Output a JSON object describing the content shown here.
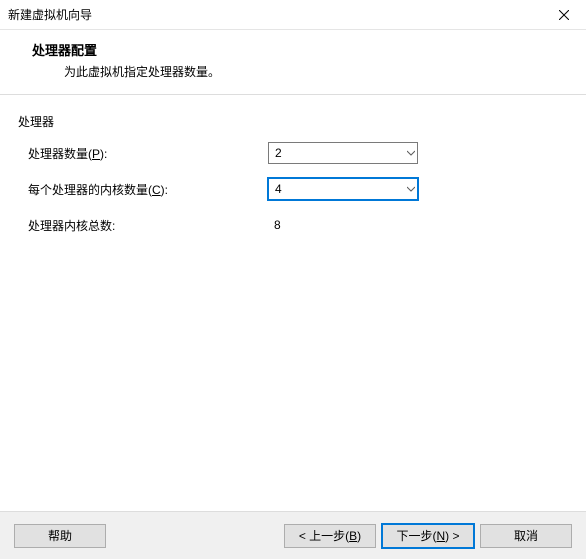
{
  "titlebar": {
    "title": "新建虚拟机向导"
  },
  "header": {
    "heading": "处理器配置",
    "subtitle": "为此虚拟机指定处理器数量。"
  },
  "group": {
    "label": "处理器",
    "processor_count": {
      "label_prefix": "处理器数量(",
      "accel": "P",
      "label_suffix": "):",
      "value": "2"
    },
    "cores_per": {
      "label_prefix": "每个处理器的内核数量(",
      "accel": "C",
      "label_suffix": "):",
      "value": "4"
    },
    "total_cores": {
      "label": "处理器内核总数:",
      "value": "8"
    }
  },
  "buttons": {
    "help": "帮助",
    "back_prefix": "< 上一步(",
    "back_accel": "B",
    "back_suffix": ")",
    "next_prefix": "下一步(",
    "next_accel": "N",
    "next_suffix": ") >",
    "cancel": "取消"
  }
}
